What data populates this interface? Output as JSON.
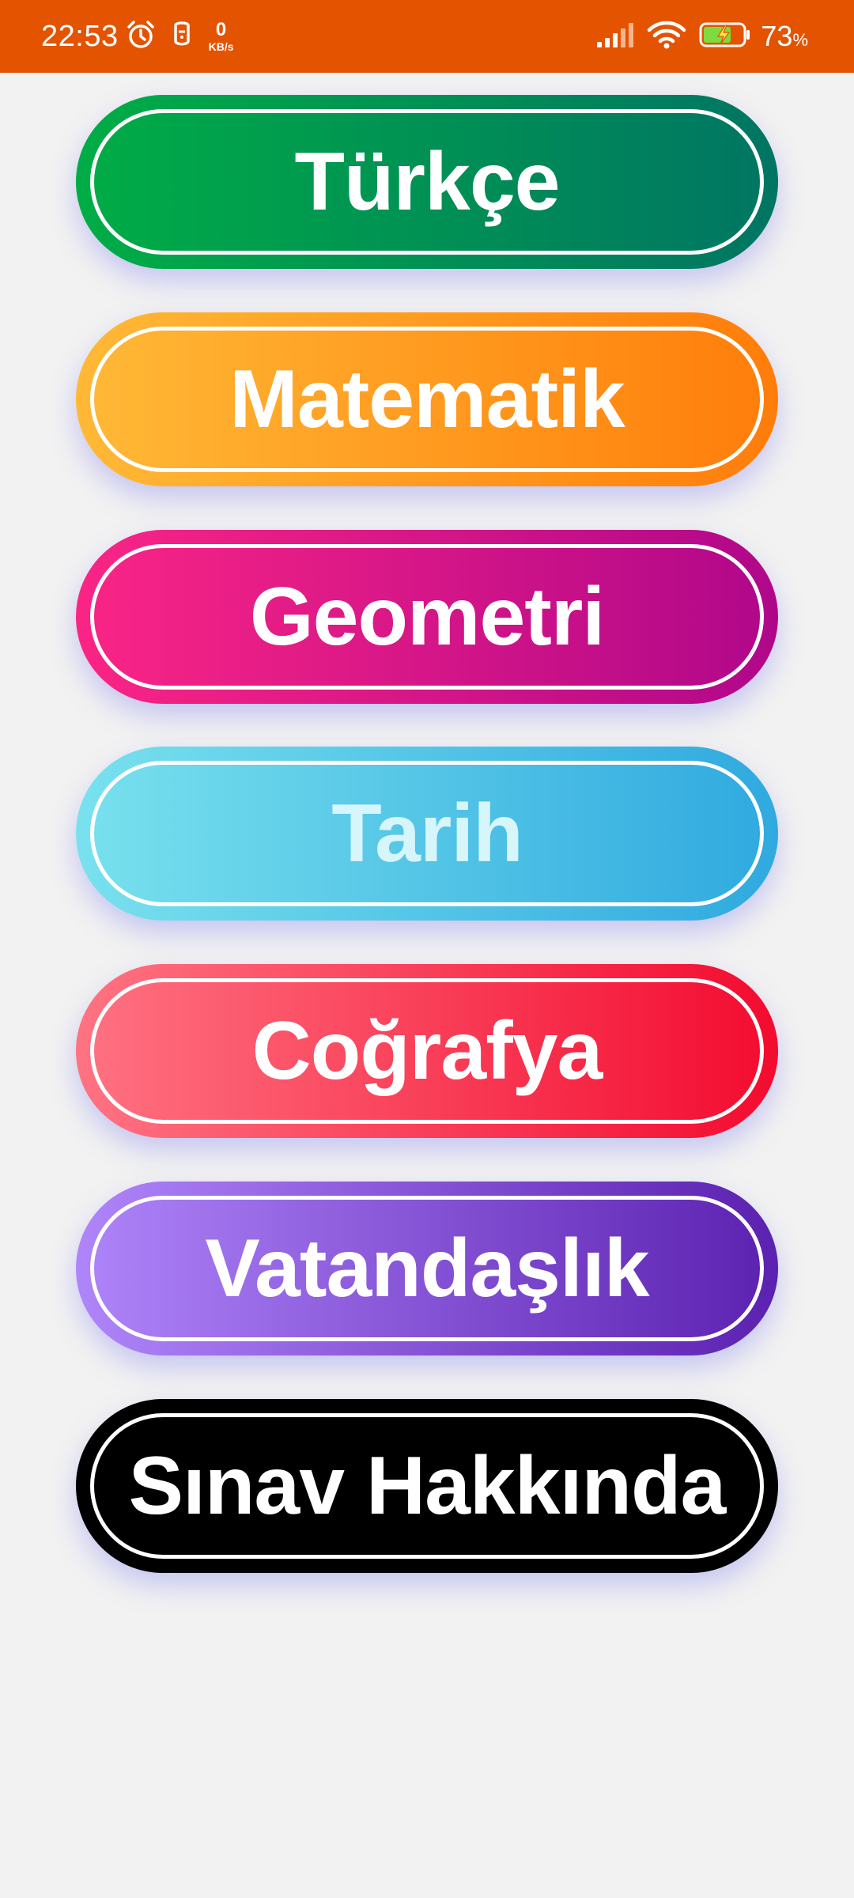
{
  "status_bar": {
    "time": "22:53",
    "net_speed_value": "0",
    "net_speed_unit": "KB/s",
    "battery_percent": "73",
    "battery_unit": "%",
    "icons": [
      "alarm-icon",
      "notification-icon",
      "signal-icon",
      "wifi-icon",
      "battery-charging-icon"
    ],
    "background_color": "#e35300"
  },
  "menu": {
    "buttons": [
      {
        "label": "Türkçe",
        "gradient": [
          "#00ad45",
          "#007563"
        ]
      },
      {
        "label": "Matematik",
        "gradient": [
          "#ffb936",
          "#ff7d0a"
        ]
      },
      {
        "label": "Geometri",
        "gradient": [
          "#fa2585",
          "#b0078a"
        ]
      },
      {
        "label": "Tarih",
        "gradient": [
          "#79e1ee",
          "#2fa9df"
        ]
      },
      {
        "label": "Coğrafya",
        "gradient": [
          "#ff7382",
          "#f30b2f"
        ]
      },
      {
        "label": "Vatandaşlık",
        "gradient": [
          "#af85fa",
          "#5b21b0"
        ]
      },
      {
        "label": "Sınav Hakkında",
        "gradient": [
          "#000000",
          "#000000"
        ]
      }
    ]
  }
}
